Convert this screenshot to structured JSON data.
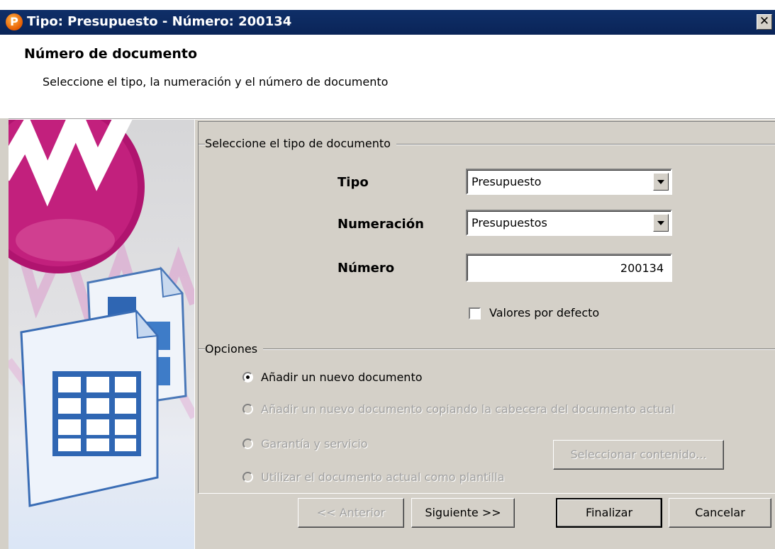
{
  "window": {
    "title": "Tipo: Presupuesto - Número: 200134",
    "app_icon_glyph": "P"
  },
  "header": {
    "title": "Número de documento",
    "subtitle": "Seleccione el tipo, la numeración y el número de documento"
  },
  "doc_type_group": {
    "title": "Seleccione el tipo de documento",
    "tipo_label": "Tipo",
    "tipo_value": "Presupuesto",
    "numeracion_label": "Numeración",
    "numeracion_value": "Presupuestos",
    "numero_label": "Número",
    "numero_value": "200134",
    "defaults_label": "Valores por defecto",
    "defaults_checked": false
  },
  "options_group": {
    "title": "Opciones",
    "items": [
      {
        "label": "Añadir un nuevo documento",
        "checked": true,
        "enabled": true
      },
      {
        "label": "Añadir un nuevo documento copiando la cabecera del documento actual",
        "checked": false,
        "enabled": false
      },
      {
        "label": "Garantía y servicio",
        "checked": false,
        "enabled": false
      },
      {
        "label": "Utilizar el documento actual como plantilla",
        "checked": false,
        "enabled": false
      }
    ],
    "select_content_button": "Seleccionar contenido..."
  },
  "footer": {
    "prev": "<< Anterior",
    "next": "Siguiente >>",
    "finish": "Finalizar",
    "cancel": "Cancelar"
  },
  "colors": {
    "titlebar": "#0f2f68",
    "panel": "#d4d0c8",
    "logo_magenta": "#b0146f"
  }
}
